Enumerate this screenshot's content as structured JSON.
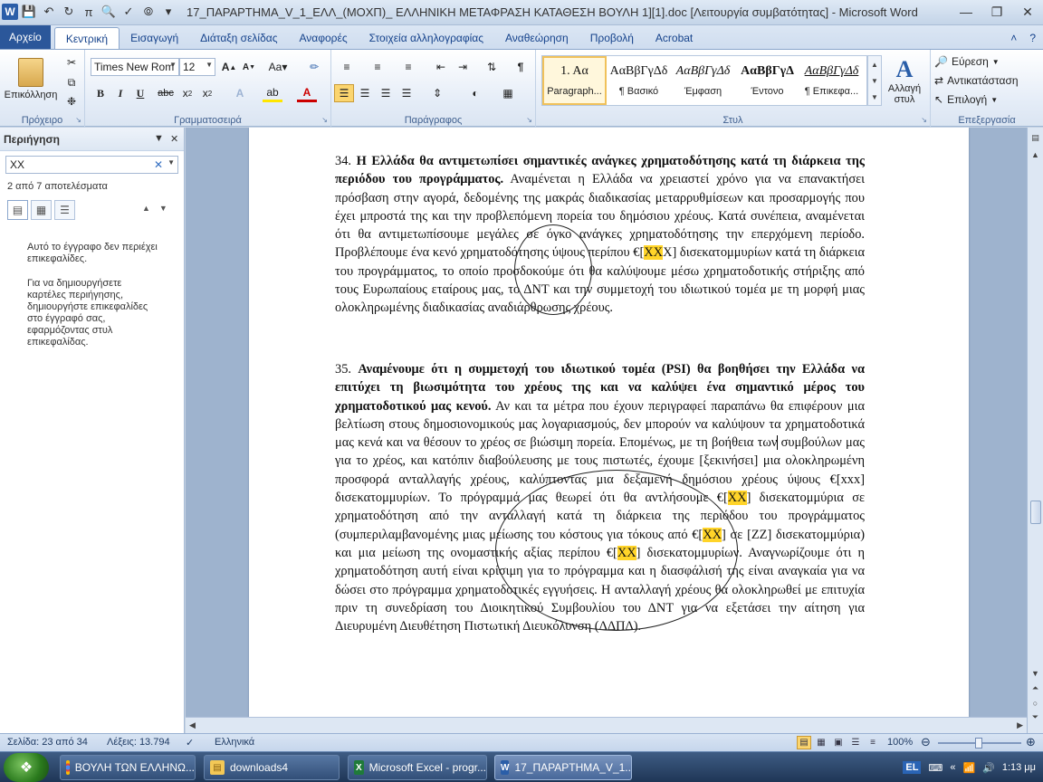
{
  "window": {
    "title": "17_ΠΑΡΑΡΤΗΜΑ_V_1_ΕΛΛ_(ΜΟΧΠ)_ ΕΛΛΗΝΙΚΗ ΜΕΤΑΦΡΑΣΗ ΚΑΤΑΘΕΣΗ ΒΟΥΛΗ 1][1].doc [Λειτουργία συμβατότητας] - Microsoft Word",
    "app_icon_letter": "W"
  },
  "ribbon_tabs": [
    "Αρχείο",
    "Κεντρική",
    "Εισαγωγή",
    "Διάταξη σελίδας",
    "Αναφορές",
    "Στοιχεία αλληλογραφίας",
    "Αναθεώρηση",
    "Προβολή",
    "Acrobat"
  ],
  "ribbon": {
    "clipboard": {
      "paste_label": "Επικόλληση",
      "group_label": "Πρόχειρο"
    },
    "font": {
      "font_name": "Times New Rom",
      "font_size": "12",
      "group_label": "Γραμματοσειρά"
    },
    "paragraph": {
      "group_label": "Παράγραφος"
    },
    "styles": {
      "group_label": "Στυλ",
      "change_styles_label": "Αλλαγή στυλ",
      "items": [
        {
          "sample": "1.  Αα",
          "name": "Paragraph..."
        },
        {
          "sample": "ΑαΒβΓγΔδ",
          "name": "¶ Βασικό"
        },
        {
          "sample": "ΑαΒβΓγΔδ",
          "name": "Έμφαση"
        },
        {
          "sample": "ΑαΒβΓγΔ",
          "name": "Έντονο"
        },
        {
          "sample": "ΑαΒβΓγΔδ",
          "name": "¶ Επικεφα..."
        }
      ]
    },
    "editing": {
      "find": "Εύρεση",
      "replace": "Αντικατάσταση",
      "select": "Επιλογή",
      "group_label": "Επεξεργασία"
    }
  },
  "nav": {
    "title": "Περιήγηση",
    "search_value": "XX",
    "results": "2 από 7 αποτελέσματα",
    "msg1": "Αυτό το έγγραφο δεν περιέχει επικεφαλίδες.",
    "msg2": "Για να δημιουργήσετε καρτέλες περιήγησης, δημιουργήστε επικεφαλίδες στο έγγραφό σας, εφαρμόζοντας στυλ επικεφαλίδας."
  },
  "document": {
    "p34": {
      "num": "34.",
      "bold": "Η Ελλάδα θα αντιμετωπίσει σημαντικές ανάγκες χρηματοδότησης κατά τη διάρκεια της περιόδου του προγράμματος.",
      "t1": " Αναμένεται η Ελλάδα να χρειαστεί χρόνο για να επανακτήσει πρόσβαση στην αγορά, δεδομένης της μακράς διαδικασίας μεταρρυθμίσεων και προσαρμογής που έχει μπροστά της και την προβλεπόμενη πορεία του δημόσιου χρέους. Κατά συνέπεια, αναμένεται ότι θα αντιμετωπίσουμε μεγάλες σε όγκο ανάγκες χρηματοδότησης την επερχόμενη περίοδο. Προβλέπουμε ένα κενό χρηματοδότησης ύψους περίπου €[",
      "h1": "XX",
      "t2": "X] δισεκατομμυρίων κατά  τη διάρκεια του προγράμματος, το οποίο προσδοκούμε ότι θα καλύψουμε μέσω χρηματοδοτικής στήριξης από τους Ευρωπαίους εταίρους  μας, το ΔΝΤ και την συμμετοχή του ιδιωτικού τομέα με τη μορφή μιας ολοκληρωμένης διαδικασίας αναδιάρθρωσης χρέους."
    },
    "p35": {
      "num": "35.",
      "bold": "Αναμένουμε ότι η συμμετοχή του ιδιωτικού τομέα (PSI) θα βοηθήσει την Ελλάδα να επιτύχει τη βιωσιμότητα του χρέους της και να καλύψει ένα σημαντικό μέρος του χρηματοδοτικού μας κενού.",
      "t1": " Αν και τα μέτρα που έχουν περιγραφεί παραπάνω θα επιφέρουν μια βελτίωση στους δημοσιονομικούς μας λογαριασμούς, δεν μπορούν να καλύψουν τα χρηματοδοτικά  μας κενά και να θέσουν το χρέος σε βιώσιμη πορεία. Επομένως, με τη βοήθεια των συμβούλων μας για το χρέος, και κατόπιν  διαβούλευσης με τους πιστωτές, έχουμε [ξεκινήσει] μια ολοκληρωμένη προσφορά ανταλλαγής χρέους, καλύπτοντας μια δεξαμενή δημόσιου χρέους ύψους €[xxx] δισεκατομμυρίων. Το πρόγραμμά μας θεωρεί ότι θα αντλήσουμε €[",
      "h1": "XX",
      "t2": "] δισεκατομμύρια σε χρηματοδότηση από την ανταλλαγή κατά τη διάρκεια της περιόδου του προγράμματος (συμπεριλαμβανομένης μιας μείωσης του κόστους για τόκους από €[",
      "h2": "XX",
      "t3": "] σε [ZZ] δισεκατομμύρια) και μια μείωση της ονομαστικής αξίας περίπου €[",
      "h3": "XX",
      "t4": "] δισεκατομμυρίων. Αναγνωρίζουμε ότι η χρηματοδότηση αυτή είναι κρίσιμη για το πρόγραμμα και η διασφάλισή της είναι αναγκαία για να δώσει στο πρόγραμμα χρηματοδοτικές εγγυήσεις. Η ανταλλαγή χρέους θα ολοκληρωθεί με επιτυχία πριν τη συνεδρίαση του Διοικητικού Συμβουλίου του ΔΝΤ για να εξετάσει την αίτηση για Διευρυμένη Διευθέτηση Πιστωτική Διευκόλυνση (ΔΔΠΔ)."
    }
  },
  "status": {
    "page": "Σελίδα: 23 από 34",
    "words": "Λέξεις: 13.794",
    "language": "Ελληνικά",
    "zoom": "100%"
  },
  "taskbar": {
    "items": [
      {
        "label": "ΒΟΥΛΗ ΤΩΝ ΕΛΛΗΝΩ...",
        "icon": "chrome-icon"
      },
      {
        "label": "downloads4",
        "icon": "folder-icon"
      },
      {
        "label": "Microsoft Excel - progr...",
        "icon": "excel-icon"
      },
      {
        "label": "17_ΠΑΡΑΡΤΗΜΑ_V_1...",
        "icon": "word-icon"
      }
    ],
    "lang": "EL",
    "clock": "1:13 μμ"
  },
  "colors": {
    "highlight": "#ffd429",
    "file_tab": "#2b579a",
    "ribbon_tab_text": "#15428b"
  }
}
